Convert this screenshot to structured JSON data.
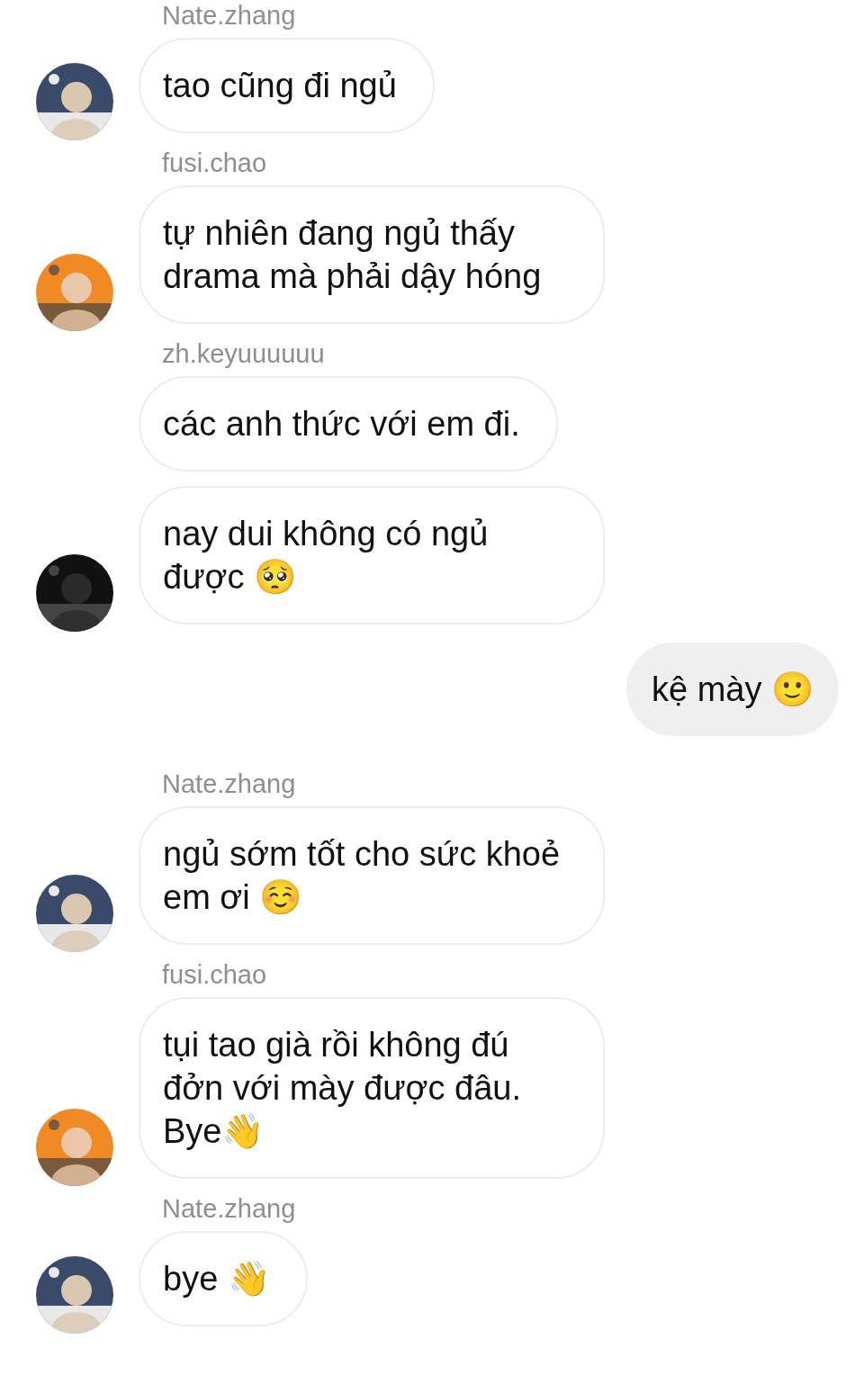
{
  "messages": [
    {
      "kind": "received",
      "sender": "Nate.zhang",
      "text": "tao cũng đi ngủ",
      "avatar": true
    },
    {
      "kind": "received",
      "sender": "fusi.chao",
      "text": "tự nhiên đang ngủ thấy drama mà phải dậy hóng",
      "avatar": true
    },
    {
      "kind": "received",
      "sender": "zh.keyuuuuuu",
      "text": "các anh thức với em đi.",
      "avatar": false
    },
    {
      "kind": "received",
      "text": "nay dui không có ngủ được 🥺",
      "avatar": true
    },
    {
      "kind": "sent",
      "text": "kệ mày 🙂"
    },
    {
      "kind": "received",
      "sender": "Nate.zhang",
      "text": "ngủ sớm tốt cho sức khoẻ em ơi ☺️",
      "avatar": true
    },
    {
      "kind": "received",
      "sender": "fusi.chao",
      "text": "tụi tao già rồi không đú đởn với mày được đâu. Bye👋",
      "avatar": true
    },
    {
      "kind": "received",
      "sender": "Nate.zhang",
      "text": "bye 👋",
      "avatar": true
    }
  ]
}
